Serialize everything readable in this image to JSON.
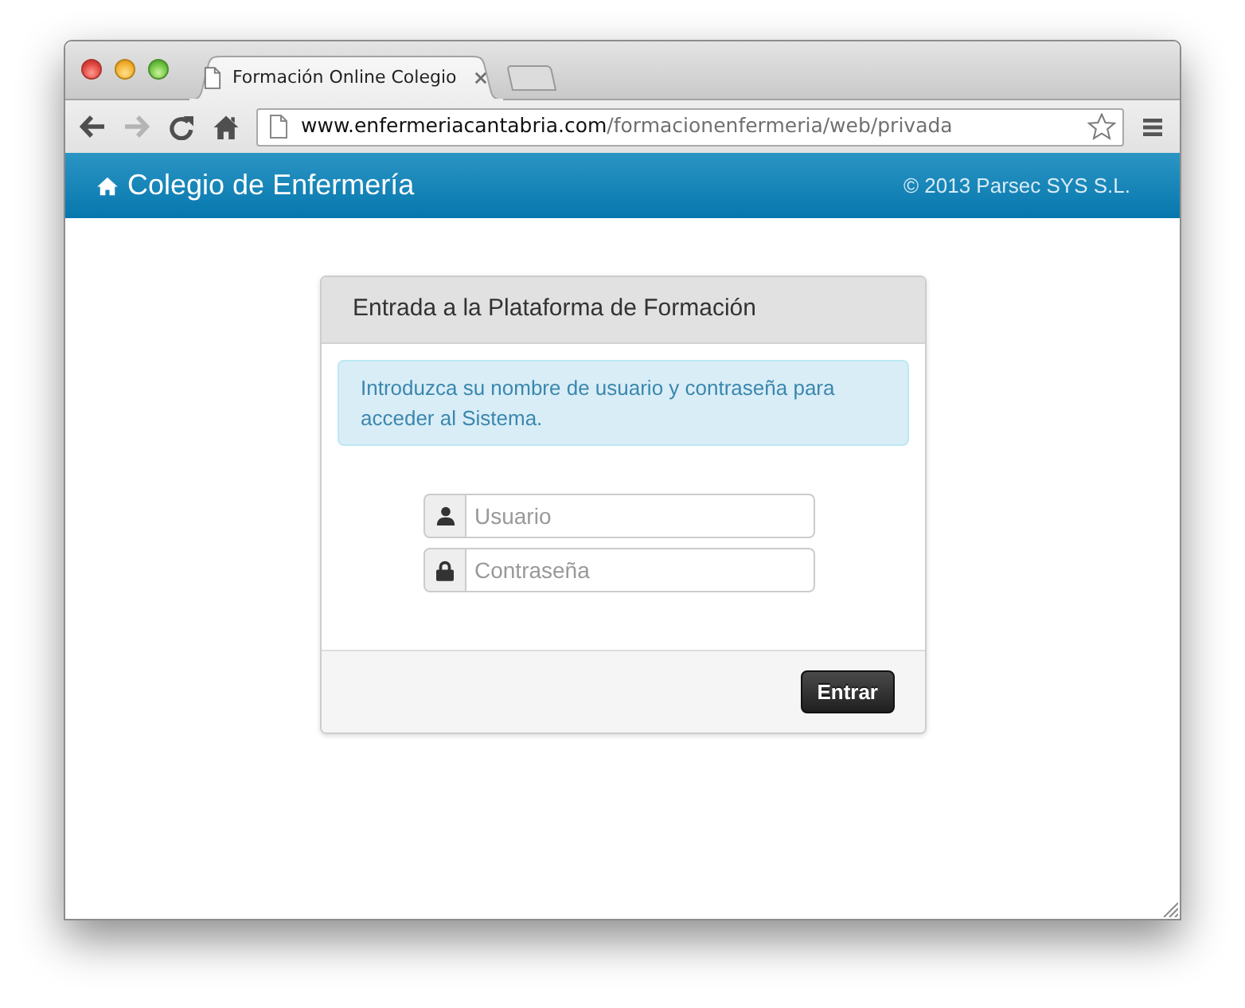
{
  "browser": {
    "tab_title": "Formación Online Colegio",
    "nav_buttons": [
      {
        "kind": "back",
        "disabled": false
      },
      {
        "kind": "forward",
        "disabled": true
      },
      {
        "kind": "reload",
        "disabled": false
      },
      {
        "kind": "home",
        "disabled": false
      }
    ],
    "url": {
      "domain": "www.enfermeriacantabria.com",
      "path": "/formacionenfermeria/web/privada"
    }
  },
  "navbar": {
    "brand": "Colegio de Enfermería",
    "copyright": "© 2013 Parsec SYS S.L."
  },
  "login_panel": {
    "heading": "Entrada a la Plataforma de Formación",
    "alert": "Introduzca su nombre de usuario y contraseña para acceder al Sistema.",
    "fields": [
      {
        "kind": "user",
        "placeholder": "Usuario"
      },
      {
        "kind": "password",
        "placeholder": "Contraseña"
      }
    ],
    "submit": "Entrar"
  }
}
